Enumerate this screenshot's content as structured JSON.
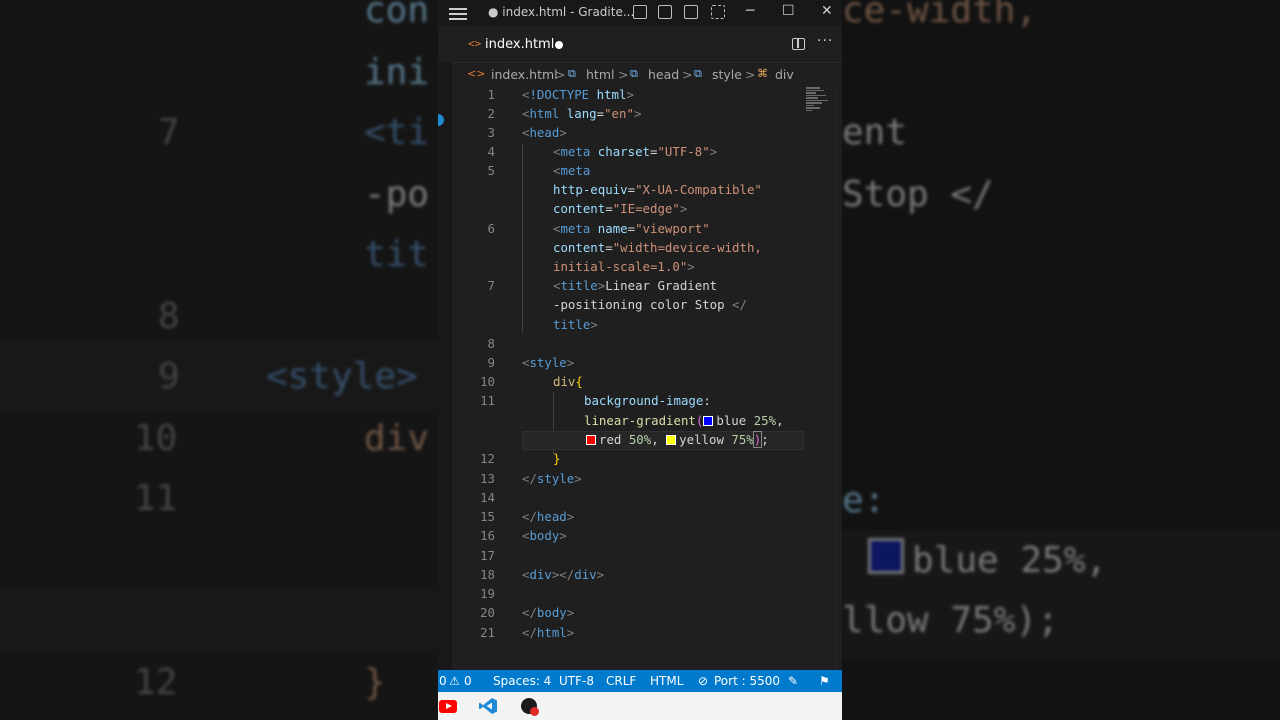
{
  "window": {
    "title": "● index.html - Gradite...",
    "controls": [
      "─",
      "☐",
      "✕"
    ]
  },
  "tab": {
    "label": "index.html",
    "icon": "<>"
  },
  "breadcrumb": {
    "items": [
      {
        "label": "index.html",
        "icon": "<>"
      },
      {
        "label": "html",
        "icon": "⧉"
      },
      {
        "label": "head",
        "icon": "⧉"
      },
      {
        "label": "style",
        "icon": "⧉"
      },
      {
        "label": "div",
        "icon": "⌘"
      }
    ],
    "separator": ">"
  },
  "editor": {
    "line_numbers": [
      "1",
      "2",
      "3",
      "4",
      "5",
      "6",
      "7",
      "8",
      "9",
      "10",
      "11",
      "12",
      "13",
      "14",
      "15",
      "16",
      "17",
      "18",
      "19",
      "20",
      "21"
    ],
    "lines": {
      "l1": [
        "<",
        "!DOCTYPE",
        " ",
        "html",
        ">"
      ],
      "l2": [
        "<",
        "html",
        " ",
        "lang",
        "=",
        "\"en\"",
        ">"
      ],
      "l3": [
        "<",
        "head",
        ">"
      ],
      "l4": [
        "<",
        "meta",
        " ",
        "charset",
        "=",
        "\"UTF-8\"",
        ">"
      ],
      "l5a": [
        "<",
        "meta"
      ],
      "l5b": [
        "http-equiv",
        "=",
        "\"X-UA-Compatible\""
      ],
      "l5c": [
        "content",
        "=",
        "\"IE=edge\"",
        ">"
      ],
      "l6a": [
        "<",
        "meta",
        " ",
        "name",
        "=",
        "\"viewport\""
      ],
      "l6b": [
        "content",
        "=",
        "\"width=device-width,"
      ],
      "l6c": [
        "initial-scale=1.0\"",
        ">"
      ],
      "l7a": [
        "<",
        "title",
        ">",
        "Linear Gradient"
      ],
      "l7b": [
        "-positioning color Stop ",
        "</"
      ],
      "l7c": [
        "title",
        ">"
      ],
      "l9": [
        "<",
        "style",
        ">"
      ],
      "l10": [
        "div",
        "{"
      ],
      "l11a": [
        "background-image",
        ":"
      ],
      "l11b": [
        "linear-gradient",
        "(",
        "blue ",
        "25%",
        ","
      ],
      "l11c": [
        "red ",
        "50%",
        ", ",
        "yellow ",
        "75%",
        ")",
        ";"
      ],
      "l12": [
        "}"
      ],
      "l13": [
        "</",
        "style",
        ">"
      ],
      "l15": [
        "</",
        "head",
        ">"
      ],
      "l16": [
        "<",
        "body",
        ">"
      ],
      "l18": [
        "<",
        "div",
        ">",
        "</",
        "div",
        ">"
      ],
      "l20": [
        "</",
        "body",
        ">"
      ],
      "l21": [
        "</",
        "html",
        ">"
      ]
    },
    "swatch_colors": {
      "blue": "#0000ff",
      "red": "#ff0000",
      "yellow": "#ffff00"
    }
  },
  "status": {
    "errors": "0",
    "warnings": "0",
    "spaces": "Spaces: 4",
    "encoding": "UTF-8",
    "eol": "CRLF",
    "language": "HTML",
    "port": "Port : 5500",
    "accent": "#007acc"
  },
  "background_text": {
    "left": {
      "rows": [
        {
          "num": "",
          "code": "con"
        },
        {
          "num": "",
          "code": "ini"
        },
        {
          "num": "7",
          "code": "<ti"
        },
        {
          "num": "",
          "code": "-po"
        },
        {
          "num": "",
          "code": "tit"
        },
        {
          "num": "8",
          "code": ""
        },
        {
          "num": "9",
          "code": "<style>"
        },
        {
          "num": "10",
          "code": "div"
        },
        {
          "num": "11",
          "code": ""
        },
        {
          "num": "12",
          "code": "}"
        }
      ]
    },
    "right": {
      "rows": [
        "ce-width,",
        "ent",
        "Stop </",
        "e:",
        "blue 25%,",
        "llow 75%);"
      ]
    }
  }
}
